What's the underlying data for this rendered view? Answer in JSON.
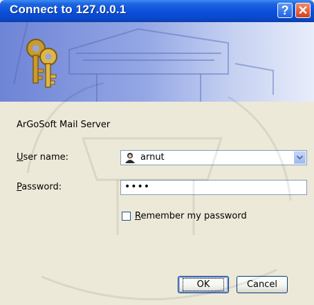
{
  "window": {
    "title": "Connect to 127.0.0.1",
    "help_glyph": "?",
    "close_glyph": "✕"
  },
  "realm": "ArGoSoft Mail Server",
  "username": {
    "label_accel": "U",
    "label_rest": "ser name:",
    "value": "arnut",
    "icon": "user-icon"
  },
  "password": {
    "label_accel": "P",
    "label_rest": "assword:",
    "value": "••••"
  },
  "remember": {
    "label_accel": "R",
    "label_rest": "emember my password",
    "checked": false
  },
  "buttons": {
    "ok": "OK",
    "cancel": "Cancel"
  },
  "colors": {
    "titlebar": "#0A4FD8",
    "dialog_bg": "#ECE9D8",
    "banner_start": "#6E84D6",
    "banner_end": "#E8EDFA"
  }
}
